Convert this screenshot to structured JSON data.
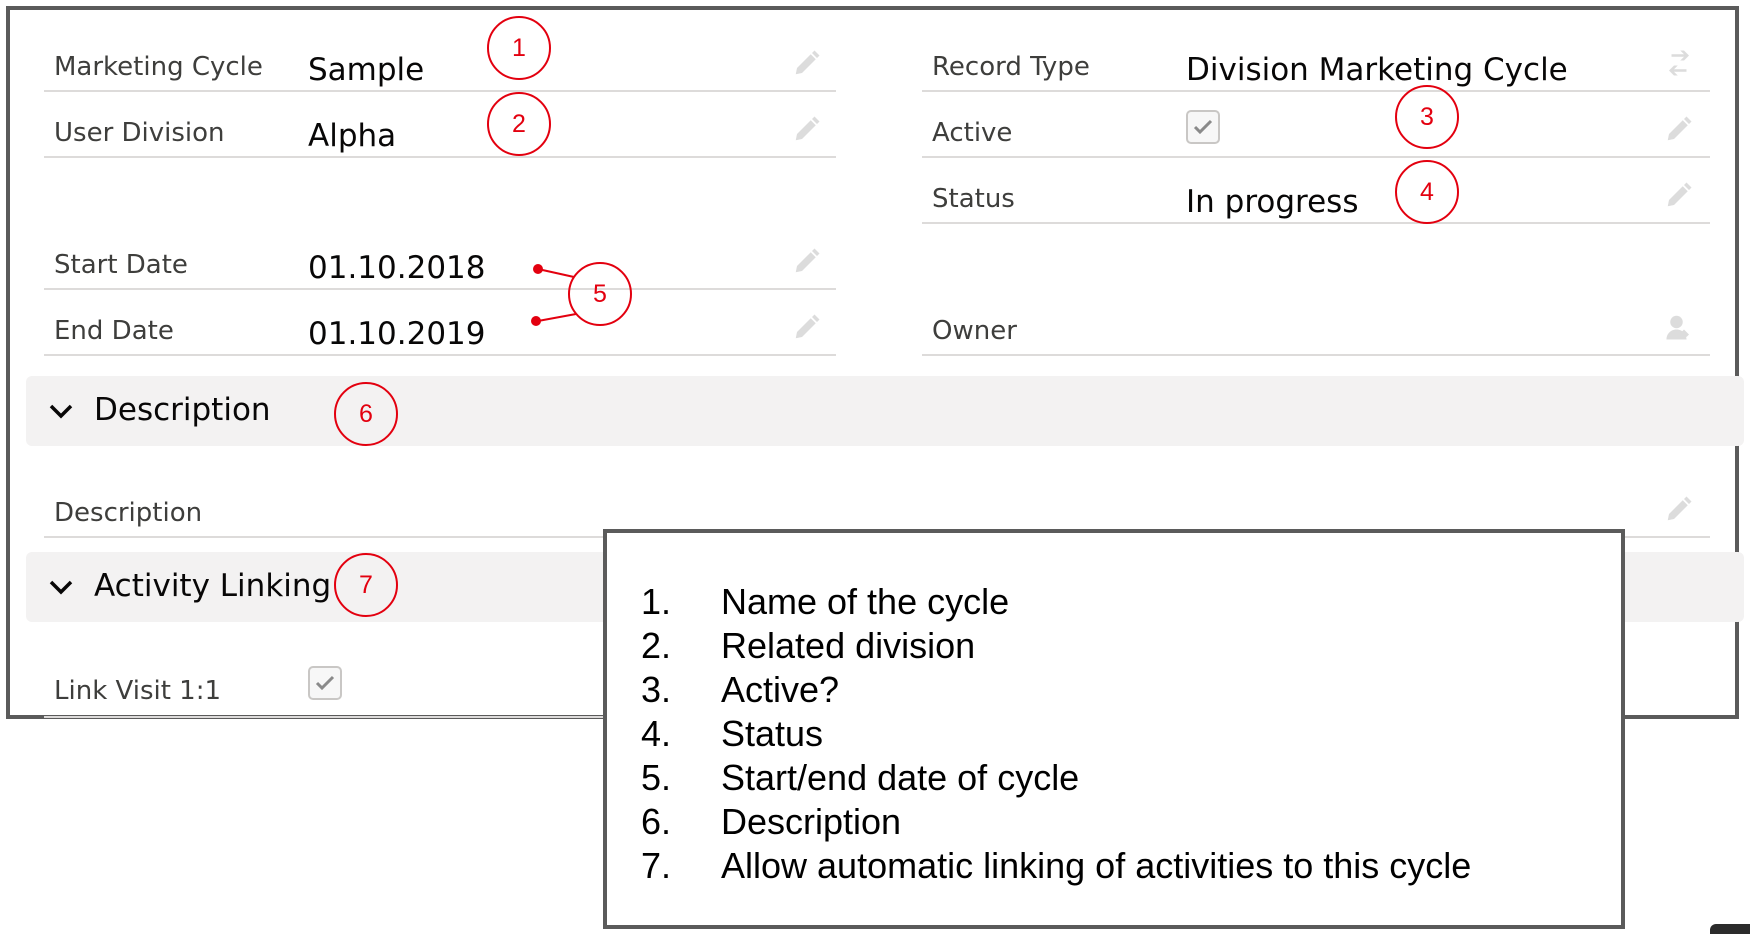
{
  "fields": {
    "marketing_cycle": {
      "label": "Marketing Cycle",
      "value": "Sample"
    },
    "user_division": {
      "label": "User Division",
      "value": "Alpha"
    },
    "start_date": {
      "label": "Start Date",
      "value": "01.10.2018"
    },
    "end_date": {
      "label": "End Date",
      "value": "01.10.2019"
    },
    "record_type": {
      "label": "Record Type",
      "value": "Division Marketing Cycle"
    },
    "active": {
      "label": "Active",
      "checked": true
    },
    "status": {
      "label": "Status",
      "value": "In progress"
    },
    "owner": {
      "label": "Owner",
      "value": ""
    }
  },
  "sections": {
    "description": {
      "title": "Description",
      "field_label": "Description"
    },
    "activity_linking": {
      "title": "Activity Linking",
      "field_label": "Link Visit 1:1",
      "checked": true
    }
  },
  "callouts": [
    "1",
    "2",
    "3",
    "4",
    "5",
    "6",
    "7"
  ],
  "legend": [
    {
      "num": "1.",
      "text": "Name of the cycle"
    },
    {
      "num": "2.",
      "text": "Related division"
    },
    {
      "num": "3.",
      "text": "Active?"
    },
    {
      "num": "4.",
      "text": "Status"
    },
    {
      "num": "5.",
      "text": "Start/end date of cycle"
    },
    {
      "num": "6.",
      "text": "Description"
    },
    {
      "num": "7.",
      "text": "Allow automatic linking of activities to this cycle"
    }
  ],
  "colors": {
    "callout": "#e3000f",
    "frame": "#5b5b5b",
    "section_bg": "#f3f2f2",
    "divider": "#dddbda"
  },
  "icons": [
    "pencil-icon",
    "record-type-change-icon",
    "owner-change-icon",
    "checkmark-icon",
    "chevron-down-icon"
  ]
}
